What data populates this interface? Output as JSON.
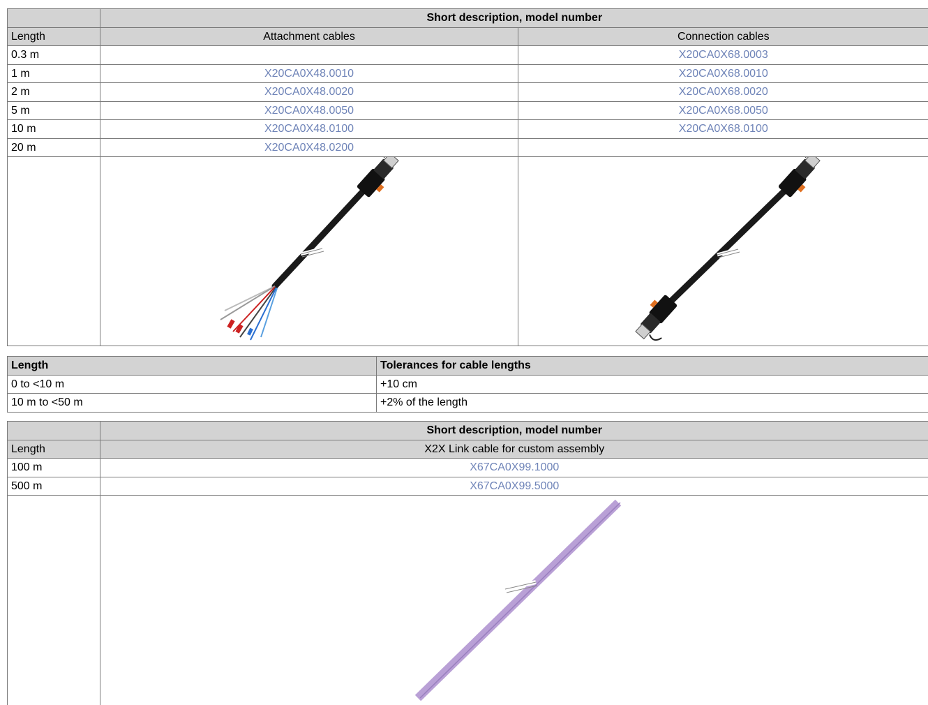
{
  "table1": {
    "header": "Short description, model number",
    "col_length": "Length",
    "col_attachment": "Attachment cables",
    "col_connection": "Connection cables",
    "rows": [
      {
        "length": "0.3 m",
        "attachment": "",
        "connection": "X20CA0X68.0003"
      },
      {
        "length": "1 m",
        "attachment": "X20CA0X48.0010",
        "connection": "X20CA0X68.0010"
      },
      {
        "length": "2 m",
        "attachment": "X20CA0X48.0020",
        "connection": "X20CA0X68.0020"
      },
      {
        "length": "5 m",
        "attachment": "X20CA0X48.0050",
        "connection": "X20CA0X68.0050"
      },
      {
        "length": "10 m",
        "attachment": "X20CA0X48.0100",
        "connection": "X20CA0X68.0100"
      },
      {
        "length": "20 m",
        "attachment": "X20CA0X48.0200",
        "connection": ""
      }
    ]
  },
  "table2": {
    "col_length": "Length",
    "col_tolerance": "Tolerances for cable lengths",
    "rows": [
      {
        "length": "0 to <10 m",
        "tolerance": "+10 cm"
      },
      {
        "length": "10 m to <50 m",
        "tolerance": "+2% of the length"
      }
    ]
  },
  "table3": {
    "header": "Short description, model number",
    "col_length": "Length",
    "col_cable": "X2X Link cable for custom assembly",
    "rows": [
      {
        "length": "100 m",
        "model": "X67CA0X99.1000"
      },
      {
        "length": "500 m",
        "model": "X67CA0X99.5000"
      }
    ]
  },
  "colors": {
    "header_bg": "#d3d3d3",
    "link": "#6f84b8",
    "border": "#7a7a7a",
    "cable_purple": "#b9a0d6"
  }
}
